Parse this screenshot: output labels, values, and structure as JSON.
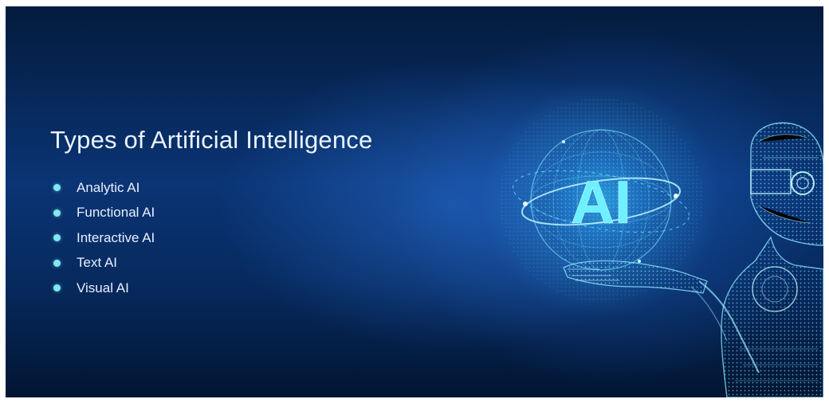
{
  "slide": {
    "title": "Types of Artificial Intelligence",
    "items": [
      {
        "label": "Analytic AI"
      },
      {
        "label": "Functional AI"
      },
      {
        "label": "Interactive AI"
      },
      {
        "label": "Text AI"
      },
      {
        "label": "Visual AI"
      }
    ]
  },
  "illustration": {
    "logo_text": "AI",
    "icon": "robot-holding-ai-globe-illustration"
  },
  "colors": {
    "background_dark": "#041b3d",
    "background_mid": "#0a3474",
    "bullet": "#7fe8f2",
    "glow": "#5ee3ff"
  }
}
